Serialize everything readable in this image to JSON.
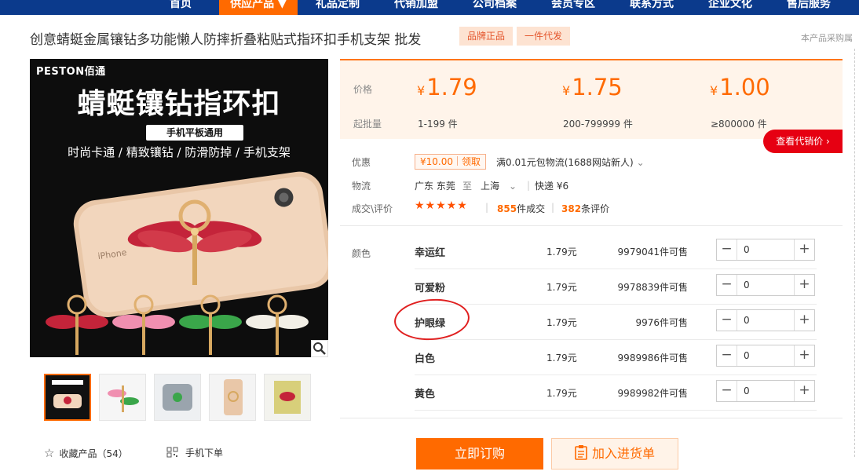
{
  "nav": [
    "首页",
    "供应产品 ▼",
    "礼品定制",
    "代销加盟",
    "公司档案",
    "会员专区",
    "联系方式",
    "企业文化",
    "售后服务"
  ],
  "product": {
    "title": "创意蜻蜓金属镶钻多功能懒人防摔折叠粘贴式指环扣手机支架 批发",
    "tags": [
      "品牌正品",
      "一件代发"
    ],
    "right_note": "本产品采购属"
  },
  "image": {
    "brand": "PESTON佰通",
    "headline": "蜻蜓镶钻指环扣",
    "subtag": "手机平板通用",
    "slogan": "时尚卡通 / 精致镶钻 / 防滑防掉 / 手机支架"
  },
  "footer_links": {
    "favorite": "收藏产品（54）",
    "mobile": "手机下单"
  },
  "price": {
    "price_label": "价格",
    "qty_label": "起批量",
    "currency": "¥",
    "tiers": [
      {
        "price": "1.79",
        "qty": "1-199 件"
      },
      {
        "price": "1.75",
        "qty": "200-799999 件"
      },
      {
        "price": "1.00",
        "qty": "≥800000 件"
      }
    ],
    "agent_button": "查看代销价 ›"
  },
  "promo": {
    "label": "优惠",
    "coupon_value": "¥10.00",
    "coupon_action": "领取",
    "text": "满0.01元包物流(1688网站新人)"
  },
  "logistics": {
    "label": "物流",
    "from": "广东 东莞",
    "to_word": "至",
    "to": "上海",
    "method": "快递 ¥6"
  },
  "deals": {
    "label": "成交\\评价",
    "stars": "★★★★★",
    "deal_count": "855",
    "deal_suffix": "件成交",
    "review_count": "382",
    "review_suffix": "条评价"
  },
  "sku": {
    "label": "颜色",
    "rows": [
      {
        "name": "幸运红",
        "price": "1.79元",
        "stock": "9979041件可售",
        "qty": "0"
      },
      {
        "name": "可爱粉",
        "price": "1.79元",
        "stock": "9978839件可售",
        "qty": "0"
      },
      {
        "name": "护眼绿",
        "price": "1.79元",
        "stock": "9976件可售",
        "qty": "0"
      },
      {
        "name": "白色",
        "price": "1.79元",
        "stock": "9989986件可售",
        "qty": "0"
      },
      {
        "name": "黄色",
        "price": "1.79元",
        "stock": "9989982件可售",
        "qty": "0"
      }
    ]
  },
  "actions": {
    "order": "立即订购",
    "cart": "加入进货单"
  },
  "colors": {
    "accent": "#ff6a00",
    "nav_bg": "#0b3a8c",
    "agent_red": "#e60012"
  }
}
